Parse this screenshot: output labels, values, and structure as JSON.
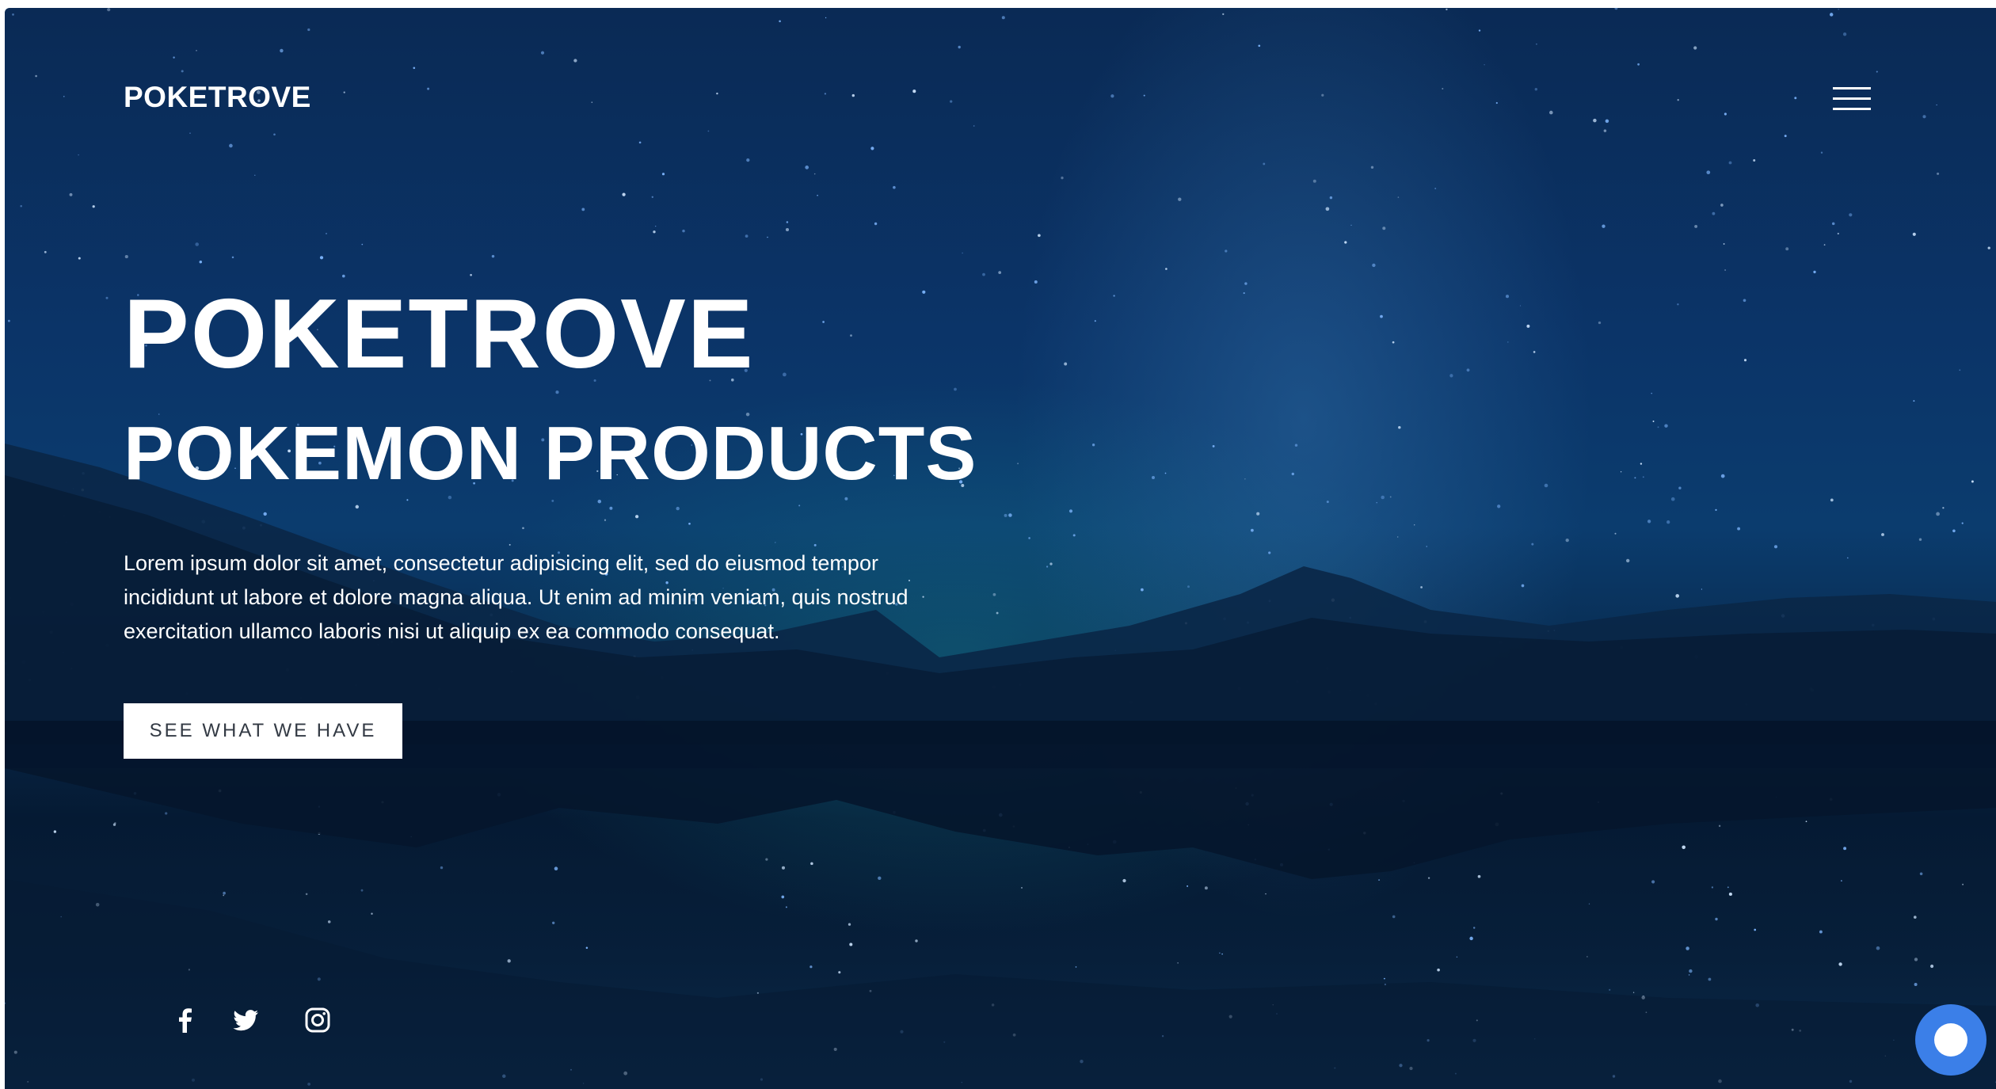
{
  "header": {
    "brand": "POKETROVE",
    "menu_icon": "hamburger-menu-icon"
  },
  "hero": {
    "title": "POKETROVE",
    "subtitle": "POKEMON PRODUCTS",
    "description": "Lorem ipsum dolor sit amet, consectetur adipisicing elit, sed do eiusmod tempor incididunt ut labore et dolore magna aliqua. Ut enim ad minim veniam, quis nostrud exercitation ullamco laboris nisi ut aliquip ex ea commodo consequat.",
    "cta_label": "SEE WHAT WE HAVE"
  },
  "social": [
    {
      "icon": "facebook-icon"
    },
    {
      "icon": "twitter-icon"
    },
    {
      "icon": "instagram-icon"
    }
  ],
  "chat": {
    "icon": "chat-bubble-icon",
    "color": "#3b7fe8"
  },
  "colors": {
    "text": "#ffffff",
    "cta_background": "#ffffff",
    "cta_text": "#333a44",
    "sky_top": "#0a2a55",
    "sky_glow": "#14788c"
  }
}
